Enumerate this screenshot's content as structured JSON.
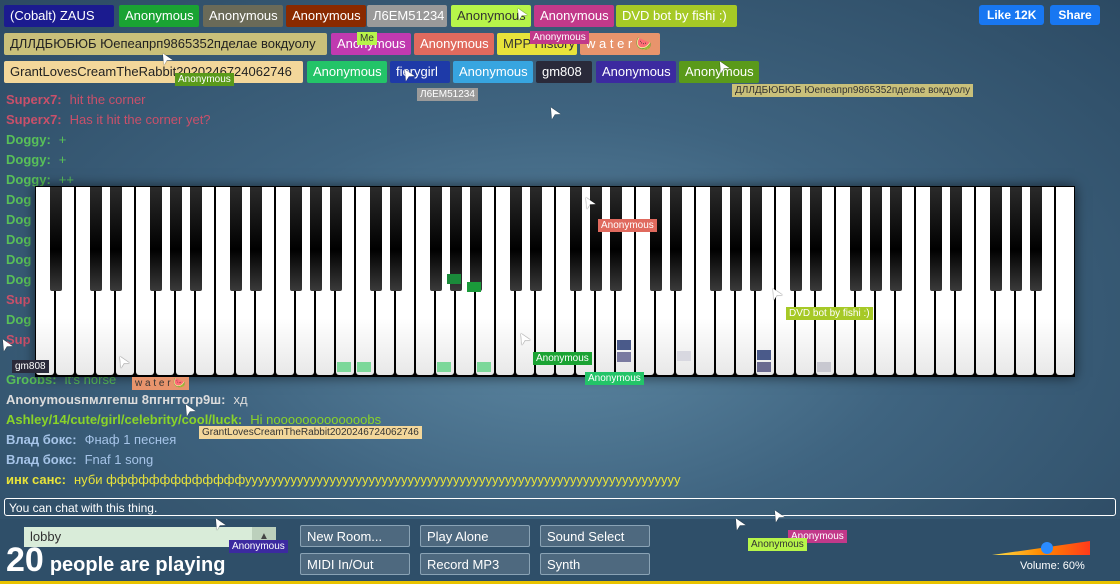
{
  "users": [
    {
      "name": "(Cobalt) ZAUS",
      "color": "#1b1b8f"
    },
    {
      "name": "Anonymous",
      "color": "#1aa333"
    },
    {
      "name": "Anonymous",
      "color": "#6a6a58"
    },
    {
      "name": "Anonymous",
      "color": "#8a2a00"
    },
    {
      "name": "Л6ЕМ51234",
      "color": "#9a9a9a"
    },
    {
      "name": "Anonymous",
      "color": "#b7f54a"
    },
    {
      "name": "Anonymous",
      "color": "#c2398a"
    },
    {
      "name": "DVD bot by fishi :)",
      "color": "#a6c926"
    },
    {
      "name": "ДЛЛДБЮБЮБ Юепеапрп9865352пделае вокдуолу",
      "color": "#c9c07a"
    },
    {
      "name": "Anonymous",
      "color": "#c03ab0"
    },
    {
      "name": "Anonymous",
      "color": "#e06a5e"
    },
    {
      "name": "MPP History",
      "color": "#e8e33a"
    },
    {
      "name": "w a t e r 🍉",
      "color": "#e8946c"
    },
    {
      "name": "GrantLovesCreamTheRabbit2020246724062746",
      "color": "#f3d79a"
    },
    {
      "name": "Anonymous",
      "color": "#23c468"
    },
    {
      "name": "fierygirl",
      "color": "#1e3aa8"
    },
    {
      "name": "Anonymous",
      "color": "#37a5e0"
    },
    {
      "name": "gm808",
      "color": "#2a2a3a"
    },
    {
      "name": "Anonymous",
      "color": "#3c2aa0"
    },
    {
      "name": "Anonymous",
      "color": "#5a9a1a"
    }
  ],
  "facebook": {
    "like": "Like 12K",
    "share": "Share"
  },
  "chat": [
    {
      "name": "Superx7:",
      "text": "hit the corner",
      "color": "#c9506a"
    },
    {
      "name": "Superx7:",
      "text": "Has it hit the corner yet?",
      "color": "#c9506a"
    },
    {
      "name": "Doggy:",
      "text": "+",
      "color": "#58c058"
    },
    {
      "name": "Doggy:",
      "text": "+",
      "color": "#58c058"
    },
    {
      "name": "Doggy:",
      "text": "++",
      "color": "#58c058"
    },
    {
      "name": "Dog",
      "text": "",
      "color": "#58c058"
    },
    {
      "name": "Dog",
      "text": "",
      "color": "#58c058"
    },
    {
      "name": "Dog",
      "text": "",
      "color": "#58c058"
    },
    {
      "name": "Dog",
      "text": "",
      "color": "#58c058"
    },
    {
      "name": "Dog",
      "text": "",
      "color": "#58c058"
    },
    {
      "name": "Sup",
      "text": "",
      "color": "#c9506a"
    },
    {
      "name": "Dog",
      "text": "",
      "color": "#58c058"
    },
    {
      "name": "Sup",
      "text": "",
      "color": "#c9506a"
    },
    {
      "name": "",
      "text": "",
      "color": "#58c058"
    },
    {
      "name": "Groobs:",
      "text": "it's horse",
      "color": "#58c058"
    },
    {
      "name": "Anonymousпмлгепш 8пгнгтогр9ш:",
      "text": "хд",
      "color": "#dcdcdc"
    },
    {
      "name": "Ashley/14/cute/girl/celebrity/cool/luck:",
      "text": "Hi nooooooooooooobs",
      "color": "#8ad428"
    },
    {
      "name": "Влад бокс:",
      "text": "Фнаф 1 песнея",
      "color": "#a6c4e8"
    },
    {
      "name": "Влад бокс:",
      "text": "Fnaf 1 song",
      "color": "#a6c4e8"
    },
    {
      "name": "инк санс:",
      "text": "нуби фффффффффффффууууууууууууууууууууууууууууууууууууууууууууууууууууууууууууууууууу",
      "color": "#e8e33a"
    }
  ],
  "chat_placeholder": "You can chat with this thing.",
  "room": {
    "value": "lobby",
    "arrow": "▲"
  },
  "people": {
    "count": "20",
    "text": "people are playing"
  },
  "buttons": {
    "new_room": "New Room...",
    "play_alone": "Play Alone",
    "sound_select": "Sound Select",
    "midi": "MIDI In/Out",
    "record": "Record MP3",
    "synth": "Synth"
  },
  "volume": {
    "label": "Volume: 60%",
    "value": 0.6
  },
  "cursor_labels": [
    {
      "text": "Anonymous",
      "color": "#5a9a1a"
    },
    {
      "text": "Me",
      "color": "#b7f54a"
    },
    {
      "text": "Anonymous",
      "color": "#c2398a"
    },
    {
      "text": "Л6ЕМ51234",
      "color": "#9a9a9a"
    },
    {
      "text": "ДЛЛДБЮБЮБ Юепеапрп9865352пделае вокдуолу",
      "color": "#c9c07a"
    },
    {
      "text": "Anonymous",
      "color": "#e06a5e"
    },
    {
      "text": "DVD bot by fishi :)",
      "color": "#a6c926"
    },
    {
      "text": "Anonymous",
      "color": "#1aa333"
    },
    {
      "text": "Anonymous",
      "color": "#23c468"
    },
    {
      "text": "gm808",
      "color": "#2a2a3a"
    },
    {
      "text": "w a t e r 🍉",
      "color": "#e8946c"
    },
    {
      "text": "GrantLovesCreamTheRabbit2020246724062746",
      "color": "#f3d79a"
    },
    {
      "text": "Anonymous",
      "color": "#3c2aa0"
    },
    {
      "text": "Anonymous",
      "color": "#c2398a"
    },
    {
      "text": "Anonymous",
      "color": "#b7f54a"
    }
  ]
}
